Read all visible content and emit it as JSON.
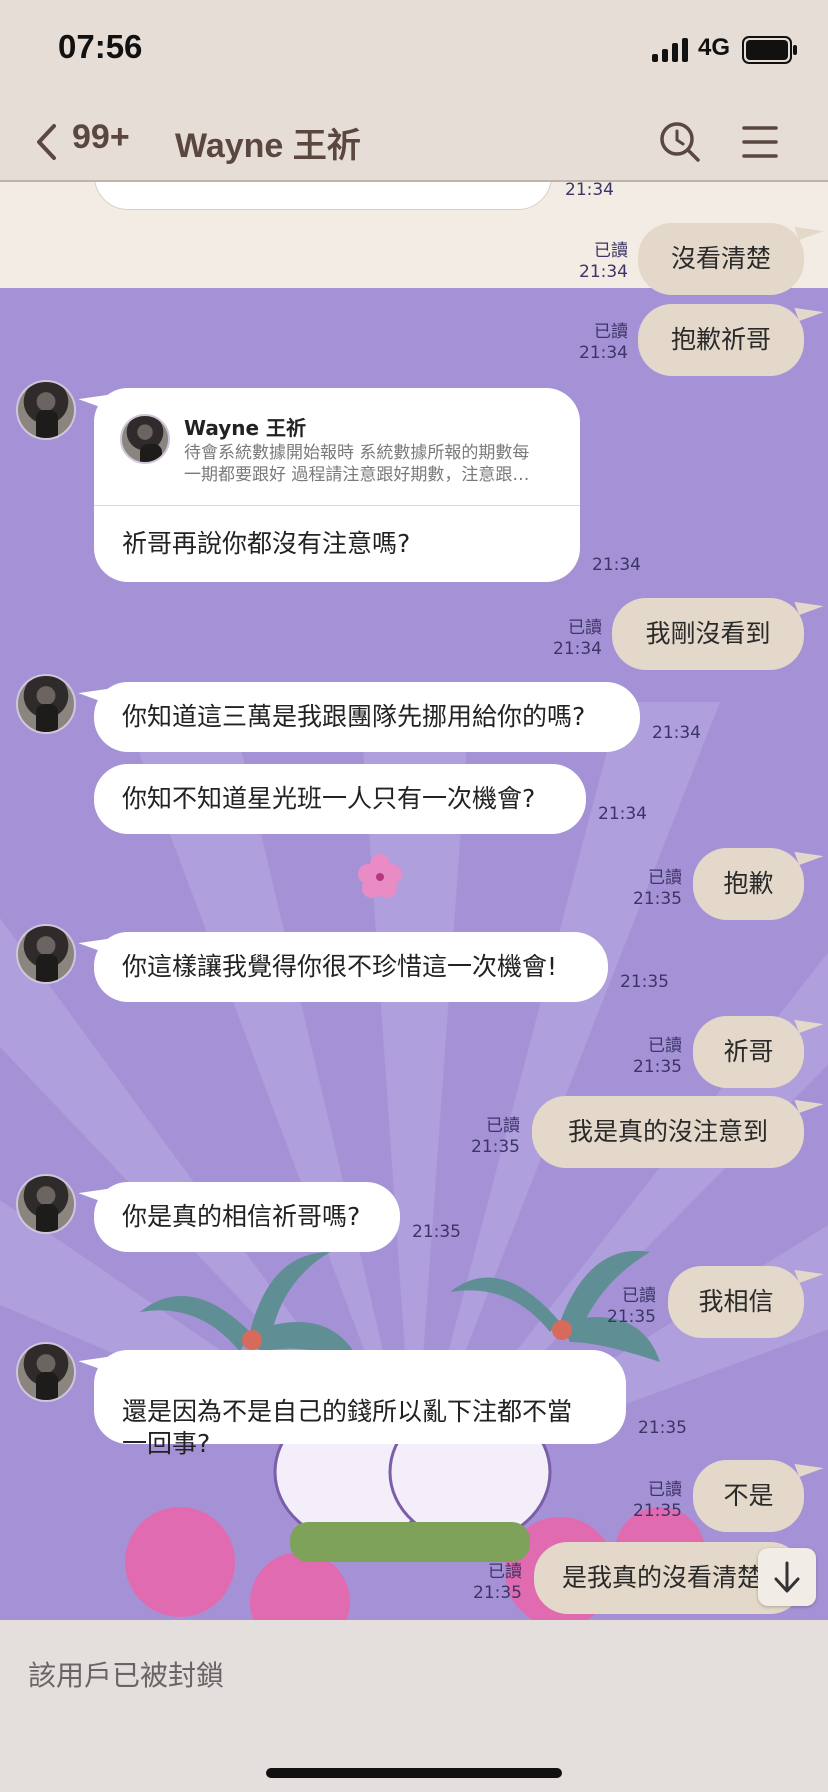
{
  "status_bar": {
    "time": "07:56",
    "network": "4G"
  },
  "header": {
    "back_count": "99+",
    "title": "Wayne 王祈"
  },
  "messages": {
    "top_time": "21:34",
    "out1": {
      "text": "沒看清楚",
      "read": "已讀",
      "time": "21:34"
    },
    "out2": {
      "text": "抱歉祈哥",
      "read": "已讀",
      "time": "21:34"
    },
    "reply": {
      "quoted_name": "Wayne 王祈",
      "quoted_text": "待會系統數據開始報時 系統數據所報的期數每\n一期都要跟好 過程請注意跟好期數，注意跟…",
      "text": "祈哥再說你都沒有注意嗎?",
      "time": "21:34"
    },
    "out3": {
      "text": "我剛沒看到",
      "read": "已讀",
      "time": "21:34"
    },
    "in1": {
      "text": "你知道這三萬是我跟團隊先挪用給你的嗎?",
      "time": "21:34"
    },
    "in2": {
      "text": "你知不知道星光班一人只有一次機會?",
      "time": "21:34"
    },
    "out4": {
      "text": "抱歉",
      "read": "已讀",
      "time": "21:35"
    },
    "in3": {
      "text": "你這樣讓我覺得你很不珍惜這一次機會!",
      "time": "21:35"
    },
    "out5": {
      "text": "祈哥",
      "read": "已讀",
      "time": "21:35"
    },
    "out6": {
      "text": "我是真的沒注意到",
      "read": "已讀",
      "time": "21:35"
    },
    "in4": {
      "text": "你是真的相信祈哥嗎?",
      "time": "21:35"
    },
    "out7": {
      "text": "我相信",
      "read": "已讀",
      "time": "21:35"
    },
    "in5": {
      "text": "還是因為不是自己的錢所以亂下注都不當\n一回事?",
      "time": "21:35"
    },
    "out8": {
      "text": "不是",
      "read": "已讀",
      "time": "21:35"
    },
    "out9": {
      "text": "是我真的沒看清楚",
      "read": "已讀",
      "time": "21:35"
    }
  },
  "bottom": {
    "blocked_notice": "該用戶已被封鎖"
  },
  "colors": {
    "chat_bg": "#a592d6",
    "header_bg": "#e6ddd6",
    "out_bubble": "#e3d8c9",
    "in_bubble": "#ffffff",
    "accent_text": "#5a4740"
  },
  "icons": {
    "back": "chevron-left-icon",
    "search": "search-icon",
    "menu": "menu-icon",
    "scroll": "arrow-down-icon"
  }
}
